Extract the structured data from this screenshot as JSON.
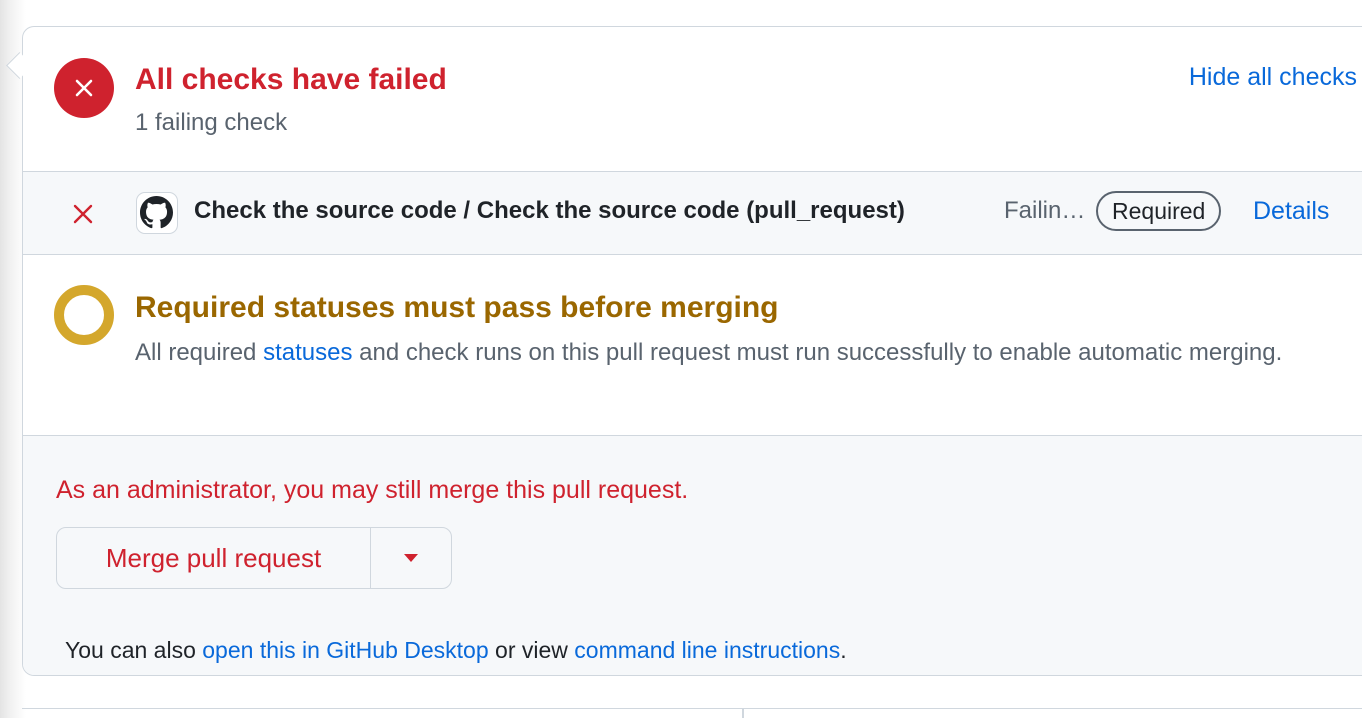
{
  "checks_summary": {
    "title": "All checks have failed",
    "subtitle": "1 failing check",
    "hide_link": "Hide all checks",
    "status_icon": "x-circle-fill-icon"
  },
  "check_row": {
    "status_icon": "x-icon",
    "app_icon": "github-mark-icon",
    "name": "Check the source code / Check the source code (pull_request)",
    "status": "Failin…",
    "badge": "Required",
    "details_link": "Details"
  },
  "required_statuses": {
    "icon": "pending-ring-icon",
    "title": "Required statuses must pass before merging",
    "desc_before": "All required ",
    "desc_link": "statuses",
    "desc_after": " and check runs on this pull request must run successfully to enable automatic merging."
  },
  "merge": {
    "admin_note": "As an administrator, you may still merge this pull request.",
    "button_label": "Merge pull request",
    "caret_icon": "triangle-down-icon",
    "alt_before": "You can also ",
    "alt_link_desktop": "open this in GitHub Desktop",
    "alt_middle": " or view ",
    "alt_link_cli": "command line instructions",
    "alt_after": "."
  },
  "colors": {
    "danger": "#cf222e",
    "attention": "#9a6700",
    "attention_ring": "#d4a72c",
    "link": "#0969da",
    "muted": "#59636e",
    "border": "#d0d7de"
  }
}
